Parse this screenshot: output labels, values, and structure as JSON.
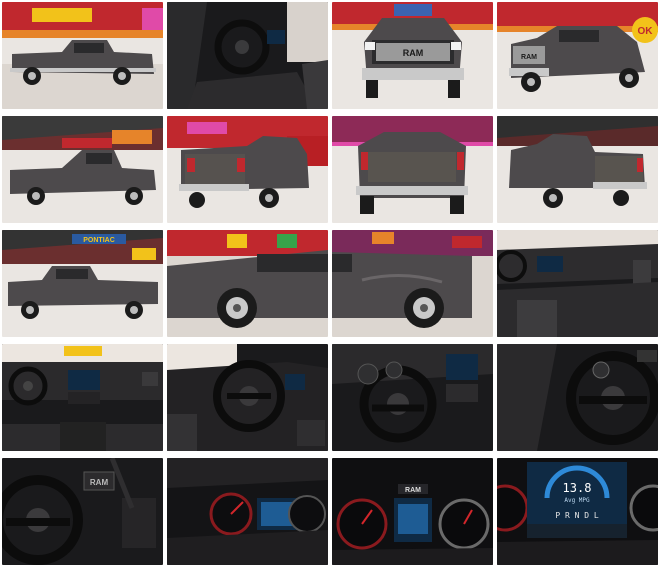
{
  "tiles": [
    {
      "view": "exterior-side-left",
      "background": "showroom"
    },
    {
      "view": "interior-driver-door-open",
      "background": "interior"
    },
    {
      "view": "exterior-front",
      "background": "showroom"
    },
    {
      "view": "exterior-front-three-quarter-right",
      "background": "showroom"
    },
    {
      "view": "exterior-side-right",
      "background": "showroom"
    },
    {
      "view": "exterior-rear-three-quarter-left",
      "background": "showroom"
    },
    {
      "view": "exterior-rear",
      "background": "showroom"
    },
    {
      "view": "exterior-rear-three-quarter-right",
      "background": "showroom"
    },
    {
      "view": "exterior-side-left-wide",
      "background": "showroom"
    },
    {
      "view": "exterior-front-wheel-closeup",
      "background": "showroom"
    },
    {
      "view": "exterior-rear-wheel-closeup",
      "background": "showroom"
    },
    {
      "view": "interior-passenger-dash",
      "background": "interior"
    },
    {
      "view": "interior-full-dashboard",
      "background": "interior"
    },
    {
      "view": "interior-steering-wheel-from-door",
      "background": "interior"
    },
    {
      "view": "interior-steering-wheel-centre-stack",
      "background": "interior"
    },
    {
      "view": "interior-steering-wheel-closeup",
      "background": "interior"
    },
    {
      "view": "interior-steering-wheel-front",
      "background": "interior"
    },
    {
      "view": "interior-gauge-cluster",
      "background": "interior"
    },
    {
      "view": "interior-gauge-cluster-closeup",
      "background": "interior"
    },
    {
      "view": "interior-digital-display-mpg",
      "background": "interior"
    }
  ],
  "truck_brand_badge": "RAM",
  "dealer_signs": {
    "sign_ok": "OK",
    "sign_pontiac": "PONTIAC"
  },
  "display_text": {
    "mpg_value": "13.8",
    "mpg_label": "Avg MPG",
    "gear_row": "P R N D L",
    "ram_logo": "RAM"
  },
  "colors": {
    "truck_body": "#4d4a4c",
    "truck_body_light": "#6a6668",
    "chrome": "#c9c9c9",
    "floor": "#eae6e2",
    "wall_red": "#b3232a",
    "wall_orange": "#e6842a",
    "neon_pink": "#e04aa8",
    "sign_yellow": "#f2c21a",
    "interior_dark": "#1a1a1c",
    "screen_blue": "#2e8ad8",
    "gauge_red": "#d2262b"
  }
}
